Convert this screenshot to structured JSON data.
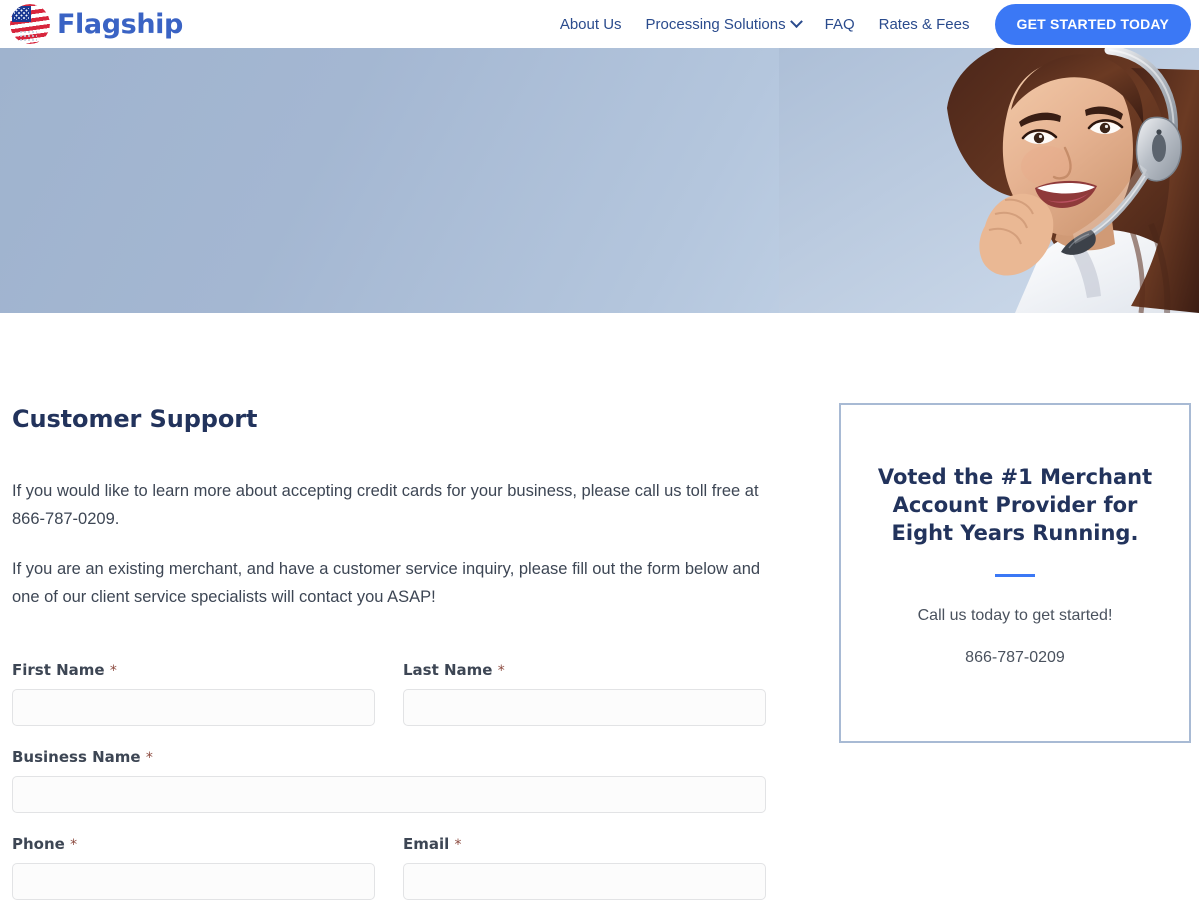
{
  "header": {
    "brand_name": "Flagship",
    "logo_icon": "flag-globe-icon",
    "nav": [
      {
        "label": "About Us",
        "has_dropdown": false
      },
      {
        "label": "Processing Solutions",
        "has_dropdown": true,
        "dropdown_icon": "chevron-down-icon"
      },
      {
        "label": "FAQ",
        "has_dropdown": false
      },
      {
        "label": "Rates & Fees",
        "has_dropdown": false
      }
    ],
    "cta_label": "GET STARTED TODAY"
  },
  "hero": {
    "image_alt": "Smiling customer service representative wearing a headset",
    "background_gradient_from": "#9fb3ce",
    "background_gradient_to": "#cfdcec"
  },
  "main": {
    "title": "Customer Support",
    "paragraphs": [
      "If you would like to learn more about accepting credit cards for your business, please call us toll free at 866-787-0209.",
      "If you are an existing merchant, and have a customer service inquiry, please fill out the form below and one of our client service specialists will contact you ASAP!"
    ]
  },
  "form": {
    "required_marker": "*",
    "rows": [
      [
        {
          "label": "First Name",
          "required": true,
          "value": "",
          "placeholder": "",
          "name": "first-name"
        },
        {
          "label": "Last Name",
          "required": true,
          "value": "",
          "placeholder": "",
          "name": "last-name"
        }
      ],
      [
        {
          "label": "Business Name",
          "required": true,
          "value": "",
          "placeholder": "",
          "name": "business-name"
        }
      ],
      [
        {
          "label": "Phone",
          "required": true,
          "value": "",
          "placeholder": "",
          "name": "phone"
        },
        {
          "label": "Email",
          "required": true,
          "value": "",
          "placeholder": "",
          "name": "email"
        }
      ]
    ]
  },
  "promo_card": {
    "title": "Voted the #1 Merchant Account Provider for Eight Years Running.",
    "subtitle": "Call us today to get started!",
    "phone": "866-787-0209",
    "divider_color": "#3b78f5",
    "border_color": "#a8bad4"
  },
  "colors": {
    "brand_blue": "#3a63c4",
    "nav_blue": "#2a4b8d",
    "cta_blue": "#3b78f5",
    "heading_navy": "#22335c",
    "body_gray": "#3d4654",
    "required_red": "#8c4a3f"
  }
}
